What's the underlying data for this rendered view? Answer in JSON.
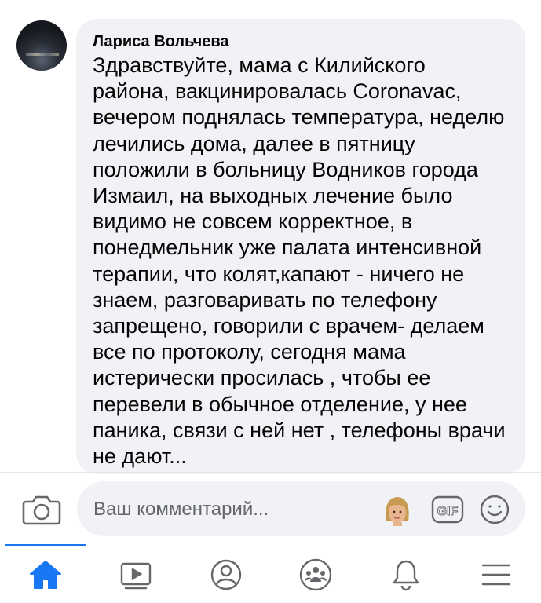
{
  "comment": {
    "author": "Лариса Вольчева",
    "text": "Здравствуйте, мама с Килийского\nрайона, вакцинировалась Coronavac,\nвечером поднялась температура, неделю\nлечились дома, далее в пятницу\nположили в больницу Водников города\nИзмаил, на выходных лечение было\nвидимо не совсем корректное, в\nпонедмельник уже палата интенсивной\nтерапии, что колят,капают - ничего не\nзнаем, разговаривать по телефону\nзапрещено, говорили с врачем- делаем\nвсе по протоколу, сегодня мама\nистерически просилась  , чтобы ее\nперевели в обычное отделение, у нее\nпаника, связи с ней нет , телефоны врачи\nне дают..."
  },
  "composer": {
    "placeholder": "Ваш комментарий...",
    "gif_label": "GIF",
    "icons": [
      "camera-icon",
      "avatar-sticker-icon",
      "gif-icon",
      "emoji-icon"
    ]
  },
  "nav": {
    "items": [
      "home",
      "watch",
      "profile",
      "groups",
      "notifications",
      "menu"
    ],
    "active": "home"
  },
  "colors": {
    "accent": "#1877f2",
    "bubble": "#f0f2f5",
    "icon_gray": "#65676b"
  }
}
